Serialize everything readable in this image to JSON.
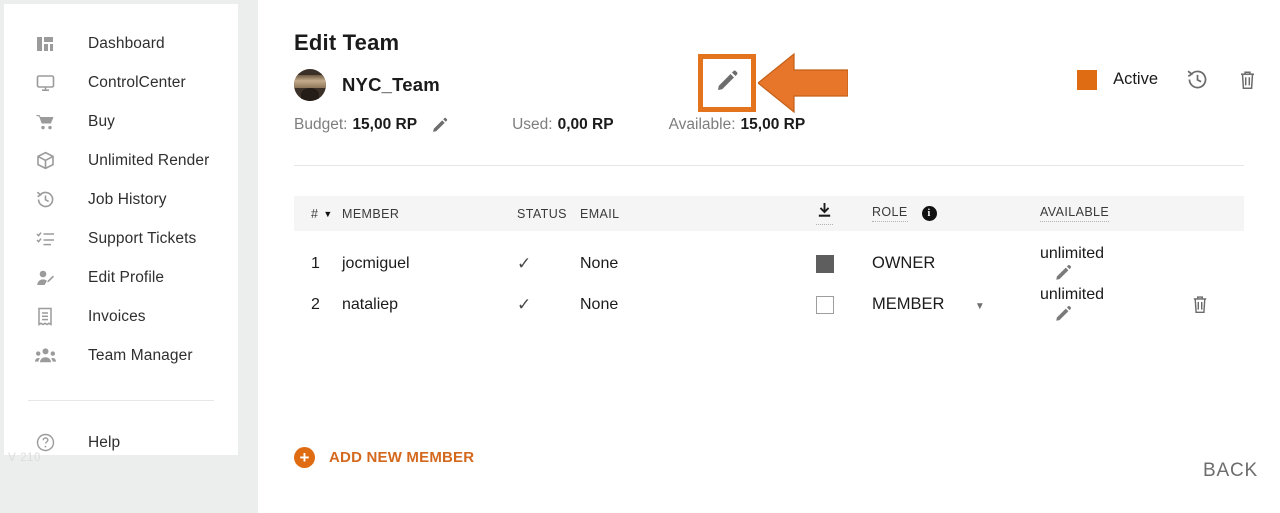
{
  "sidebar": {
    "items": [
      {
        "label": "Dashboard",
        "icon": "dashboard-icon"
      },
      {
        "label": "ControlCenter",
        "icon": "monitor-icon"
      },
      {
        "label": "Buy",
        "icon": "cart-icon"
      },
      {
        "label": "Unlimited Render",
        "icon": "box-icon"
      },
      {
        "label": "Job History",
        "icon": "history-icon"
      },
      {
        "label": "Support Tickets",
        "icon": "checklist-icon"
      },
      {
        "label": "Edit Profile",
        "icon": "user-edit-icon"
      },
      {
        "label": "Invoices",
        "icon": "invoice-icon"
      },
      {
        "label": "Team Manager",
        "icon": "team-icon"
      }
    ],
    "help": {
      "label": "Help",
      "icon": "help-circle-icon"
    },
    "version": "V 210"
  },
  "header": {
    "title": "Edit Team",
    "team_name": "NYC_Team",
    "edit_name_icon": "pencil-icon",
    "status": {
      "label": "Active",
      "color": "#df6c13",
      "history_icon": "history-icon",
      "delete_icon": "trash-icon"
    },
    "stats": [
      {
        "label": "Budget:",
        "value": "15,00 RP",
        "edit_icon": "pencil-icon"
      },
      {
        "label": "Used:",
        "value": "0,00 RP"
      },
      {
        "label": "Available:",
        "value": "15,00 RP"
      }
    ]
  },
  "table": {
    "columns": {
      "num": "#",
      "member": "MEMBER",
      "status": "STATUS",
      "email": "EMAIL",
      "download_icon": "download-icon",
      "role": "ROLE",
      "role_info_icon": "info-icon",
      "available": "AVAILABLE"
    },
    "rows": [
      {
        "num": "1",
        "member": "jocmiguel",
        "status_check": "✓",
        "email": "None",
        "checkbox": "filled",
        "role": "OWNER",
        "role_has_dropdown": false,
        "available": "unlimited",
        "edit_icon": "pencil-icon",
        "has_delete": false
      },
      {
        "num": "2",
        "member": "nataliep",
        "status_check": "✓",
        "email": "None",
        "checkbox": "empty",
        "role": "MEMBER",
        "role_has_dropdown": true,
        "available": "unlimited",
        "edit_icon": "pencil-icon",
        "has_delete": true,
        "delete_icon": "trash-icon"
      }
    ]
  },
  "footer": {
    "add_member_label": "ADD NEW MEMBER",
    "add_member_icon": "plus-circle-icon",
    "back_label": "BACK"
  },
  "annotation": {
    "highlight_color": "#e4731d",
    "arrow_color": "#e8762a",
    "target_icon": "pencil-icon"
  }
}
